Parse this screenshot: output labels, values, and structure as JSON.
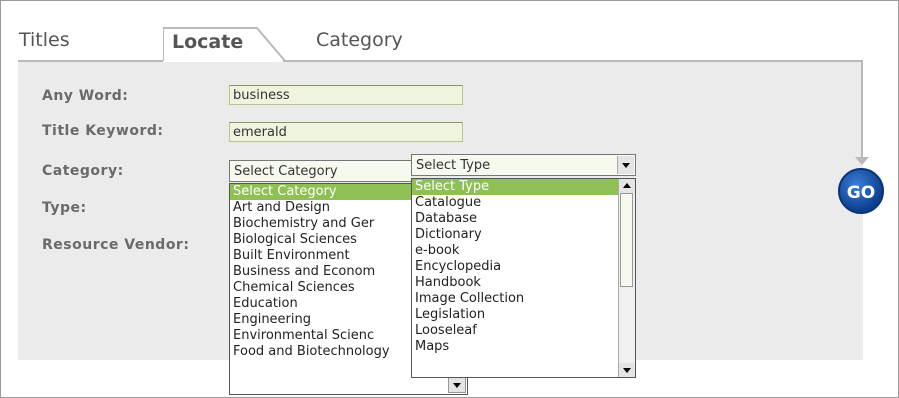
{
  "tabs": {
    "titles": "Titles",
    "locate": "Locate",
    "category": "Category"
  },
  "form": {
    "any_word_label": "Any Word:",
    "any_word_value": "business",
    "title_keyword_label": "Title Keyword:",
    "title_keyword_value": "emerald",
    "category_label": "Category:",
    "type_label": "Type:",
    "resource_vendor_label": "Resource Vendor:"
  },
  "category_select": {
    "selected": "Select Category",
    "options": [
      "Select Category",
      "Art and Design",
      "Biochemistry and Ger",
      "Biological Sciences",
      "Built Environment",
      "Business and Econom",
      "Chemical Sciences",
      "Education",
      "Engineering",
      "Environmental Scienc",
      "Food and Biotechnology"
    ]
  },
  "type_select": {
    "selected": "Select Type",
    "options": [
      "Select Type",
      "Catalogue",
      "Database",
      "Dictionary",
      "e-book",
      "Encyclopedia",
      "Handbook",
      "Image Collection",
      "Legislation",
      "Looseleaf",
      "Maps"
    ]
  },
  "go_button": "GO",
  "colors": {
    "highlight": "#8fc054",
    "input_bg": "#eef4de",
    "panel_bg": "#ebebeb",
    "go_blue": "#1a54ad"
  },
  "icons": {
    "dropdown": "chevron-down-icon",
    "scroll_up": "chevron-up-icon",
    "scroll_down": "chevron-down-icon"
  }
}
